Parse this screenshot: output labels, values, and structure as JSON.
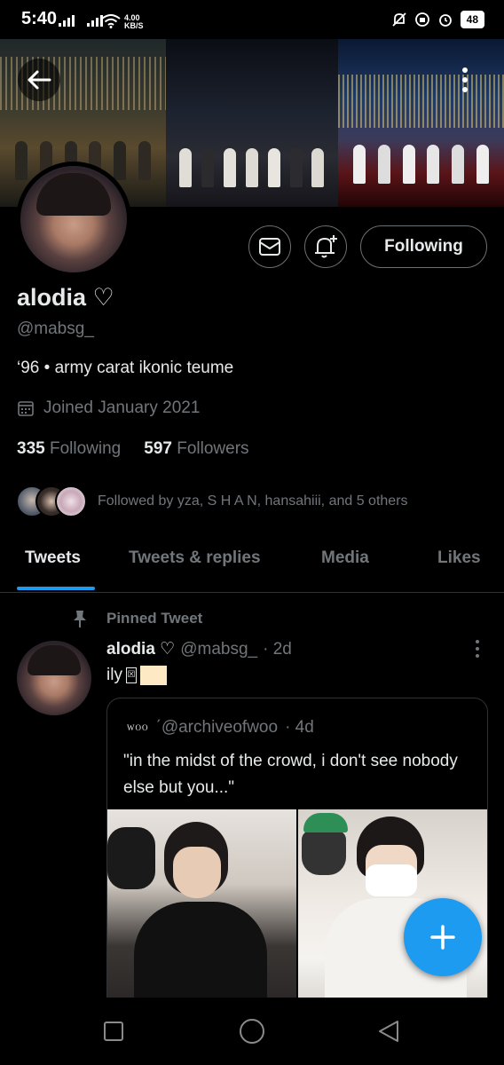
{
  "status_bar": {
    "time": "5:40",
    "net_speed_value": "4.00",
    "net_speed_unit": "KB/S",
    "battery": "48"
  },
  "profile": {
    "name": "alodia ♡",
    "handle": "@mabsg_",
    "bio": "‘96 • army carat ikonic teume",
    "joined": "Joined January 2021",
    "following_count": "335",
    "following_label": "Following",
    "followers_count": "597",
    "followers_label": "Followers",
    "followed_by": "Followed by yza, S H A N, hansahiii, and 5 others",
    "follow_button_label": "Following"
  },
  "tabs": [
    {
      "label": "Tweets",
      "active": true
    },
    {
      "label": "Tweets & replies",
      "active": false
    },
    {
      "label": "Media",
      "active": false
    },
    {
      "label": "Likes",
      "active": false
    }
  ],
  "pinned_tweet": {
    "pinned_label": "Pinned Tweet",
    "author_name": "alodia ♡",
    "author_handle": "@mabsg_",
    "time": "· 2d",
    "text": "ily",
    "text_glyph": "☒",
    "quote": {
      "logo_text": "WOO",
      "handle": "ˊ@archiveofwoo",
      "time": "· 4d",
      "text": "\"in the midst of the crowd, i don't see nobody else but you...\""
    }
  },
  "colors": {
    "accent": "#1d9bf0",
    "background": "#000000",
    "text_primary": "#e7e9ea",
    "text_secondary": "#71767b",
    "border": "#2f3336"
  },
  "icons": {
    "back": "arrow-left-icon",
    "more": "more-vertical-icon",
    "message": "envelope-icon",
    "notify": "bell-plus-icon",
    "calendar": "calendar-icon",
    "pin": "pin-icon",
    "compose": "plus-icon"
  }
}
